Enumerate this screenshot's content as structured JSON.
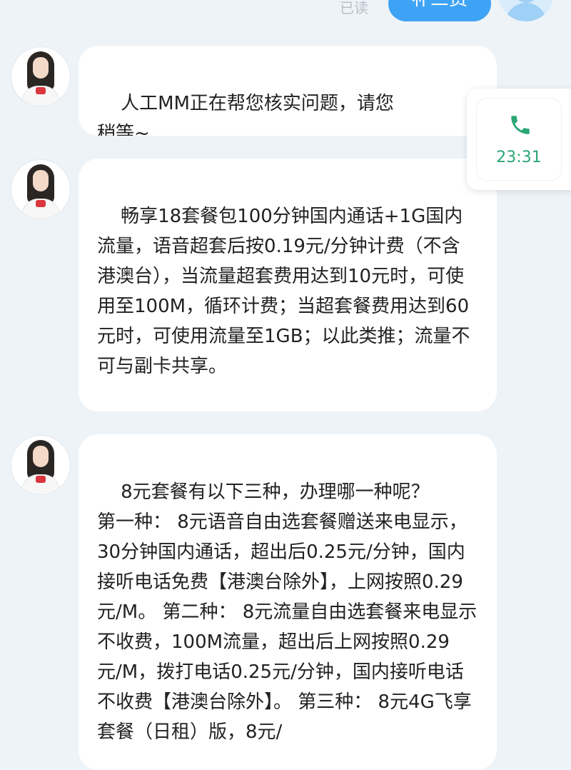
{
  "header": {
    "read_status": "已读",
    "sent_message_partial": "补三费"
  },
  "messages": [
    {
      "sender": "agent",
      "text": "人工MM正在帮您核实问题，请您稍等~"
    },
    {
      "sender": "agent",
      "text": "畅享18套餐包100分钟国内通话+1G国内流量，语音超套后按0.19元/分钟计费（不含港澳台），当流量超套费用达到10元时，可使用至100M，循环计费；当超套餐费用达到60元时，可使用流量至1GB；以此类推；流量不可与副卡共享。"
    },
    {
      "sender": "agent",
      "text": "8元套餐有以下三种，办理哪一种呢？\n第一种： 8元语音自由选套餐赠送来电显示，30分钟国内通话，超出后0.25元/分钟，国内接听电话免费【港澳台除外】，上网按照0.29元/M。 第二种： 8元流量自由选套餐来电显示不收费，100M流量，超出后上网按照0.29元/M，拨打电话0.25元/分钟，国内接听电话不收费【港澳台除外】。 第三种： 8元4G飞享套餐（日租）版，8元/"
    }
  ],
  "call_widget": {
    "icon": "phone-icon",
    "time": "23:31",
    "accent_color": "#2aa775"
  },
  "colors": {
    "background": "#eef3f8",
    "sent_bubble": "#3fa3f5",
    "bubble": "#ffffff"
  }
}
